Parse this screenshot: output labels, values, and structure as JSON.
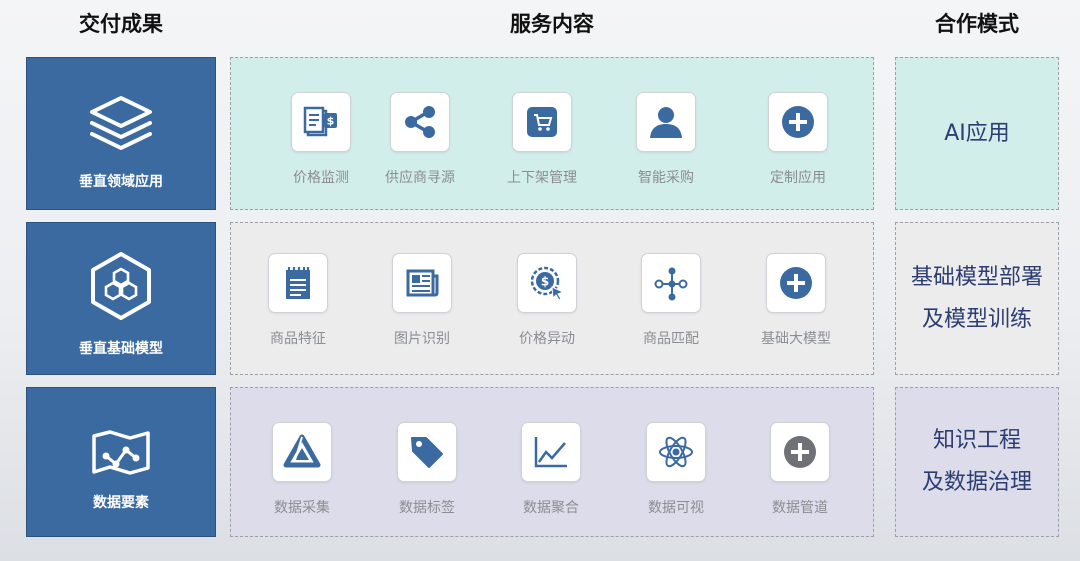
{
  "headers": {
    "deliverables": "交付成果",
    "services": "服务内容",
    "cooperation": "合作模式"
  },
  "colors": {
    "card": "#3a6aa0",
    "icon": "#3b6aa1",
    "row1": "#d2eeea",
    "row2": "#ececec",
    "row3": "#dcdcea",
    "modeText": "#2d3d72"
  },
  "rows": [
    {
      "deliverable": {
        "label": "垂直领域应用",
        "icon": "layers-icon"
      },
      "services": [
        {
          "label": "价格监测",
          "icon": "price-document-icon"
        },
        {
          "label": "供应商寻源",
          "icon": "share-icon"
        },
        {
          "label": "上下架管理",
          "icon": "cart-icon"
        },
        {
          "label": "智能采购",
          "icon": "user-icon"
        },
        {
          "label": "定制应用",
          "icon": "plus-circle-icon"
        }
      ],
      "mode": [
        "AI应用"
      ]
    },
    {
      "deliverable": {
        "label": "垂直基础模型",
        "icon": "hexagon-cluster-icon"
      },
      "services": [
        {
          "label": "商品特征",
          "icon": "notepad-icon"
        },
        {
          "label": "图片识别",
          "icon": "newspaper-icon"
        },
        {
          "label": "价格异动",
          "icon": "dollar-cursor-icon"
        },
        {
          "label": "商品匹配",
          "icon": "node-tree-icon"
        },
        {
          "label": "基础大模型",
          "icon": "plus-circle-icon"
        }
      ],
      "mode": [
        "基础模型部署",
        "及模型训练"
      ]
    },
    {
      "deliverable": {
        "label": "数据要素",
        "icon": "map-route-icon"
      },
      "services": [
        {
          "label": "数据采集",
          "icon": "triangle-logo-icon"
        },
        {
          "label": "数据标签",
          "icon": "tag-icon"
        },
        {
          "label": "数据聚合",
          "icon": "line-chart-icon"
        },
        {
          "label": "数据可视",
          "icon": "atom-icon"
        },
        {
          "label": "数据管道",
          "icon": "plus-circle-icon"
        }
      ],
      "mode": [
        "知识工程",
        "及数据治理"
      ]
    }
  ]
}
